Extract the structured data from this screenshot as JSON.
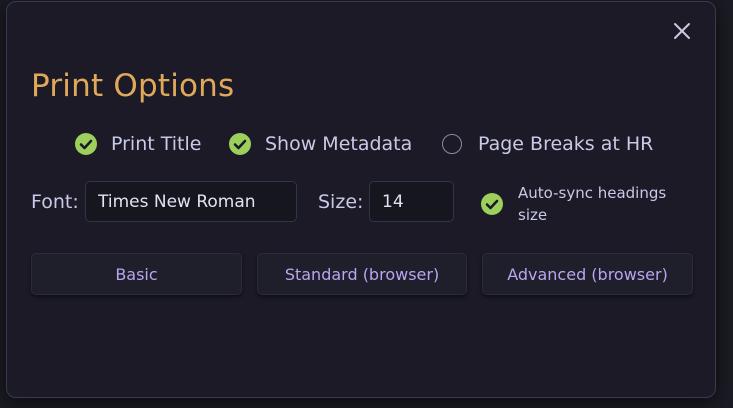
{
  "dialog": {
    "title": "Print Options",
    "close_glyph": "✕"
  },
  "options": [
    {
      "label": "Print Title",
      "checked": true
    },
    {
      "label": "Show Metadata",
      "checked": true
    },
    {
      "label": "Page Breaks at HR",
      "checked": false
    }
  ],
  "font": {
    "label": "Font:",
    "value": "Times New Roman"
  },
  "size": {
    "label": "Size:",
    "value": "14"
  },
  "autosync": {
    "label": "Auto-sync headings size",
    "checked": true
  },
  "buttons": {
    "basic": "Basic",
    "standard": "Standard (browser)",
    "advanced": "Advanced (browser)"
  },
  "colors": {
    "title": "#e0a85a",
    "check": "#9ccf5b",
    "button_text": "#b8a6f0",
    "dialog_bg": "#1b1a26"
  },
  "icons": {
    "close": "close-icon",
    "checked": "check-circle-icon",
    "unchecked": "empty-circle-icon"
  }
}
